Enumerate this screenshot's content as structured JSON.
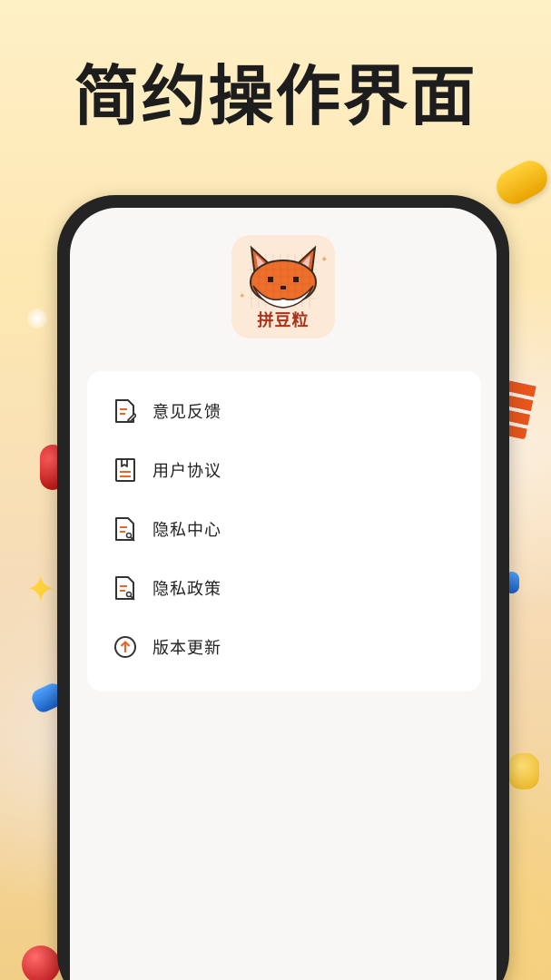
{
  "headline": "简约操作界面",
  "app": {
    "icon_name": "fox-app-icon",
    "name_on_icon": "拼豆粒"
  },
  "menu": {
    "items": [
      {
        "label": "意见反馈",
        "icon": "feedback-icon"
      },
      {
        "label": "用户协议",
        "icon": "bookmark-document-icon"
      },
      {
        "label": "隐私中心",
        "icon": "key-document-icon"
      },
      {
        "label": "隐私政策",
        "icon": "key-document-icon"
      },
      {
        "label": "版本更新",
        "icon": "arrow-up-circle-icon"
      }
    ]
  },
  "colors": {
    "accent_orange": "#e8662a",
    "text_dark": "#222222",
    "icon_outline": "#333333"
  }
}
